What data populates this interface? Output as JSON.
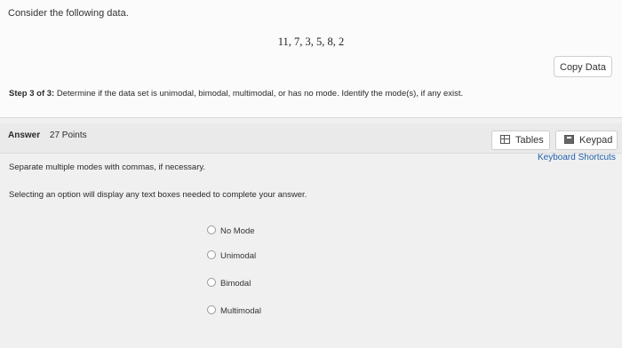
{
  "question": {
    "intro": "Consider the following data.",
    "dataset": "11, 7, 3, 5, 8, 2",
    "copy_data_label": "Copy Data",
    "step_prefix": "Step 3 of 3:",
    "step_text": "Determine if the data set is unimodal, bimodal, multimodal, or has no mode. Identify the mode(s), if any exist."
  },
  "answer": {
    "label": "Answer",
    "points": "27 Points",
    "tables_label": "Tables",
    "keypad_label": "Keypad",
    "shortcuts_label": "Keyboard Shortcuts",
    "hint_separate": "Separate multiple modes with commas, if necessary.",
    "hint_select": "Selecting an option will display any text boxes needed to complete your answer.",
    "options": [
      "No Mode",
      "Unimodal",
      "Bimodal",
      "Multimodal"
    ]
  },
  "icons": {
    "tables": "table-icon",
    "keypad": "keypad-icon",
    "radio": "radio-unchecked-icon"
  }
}
